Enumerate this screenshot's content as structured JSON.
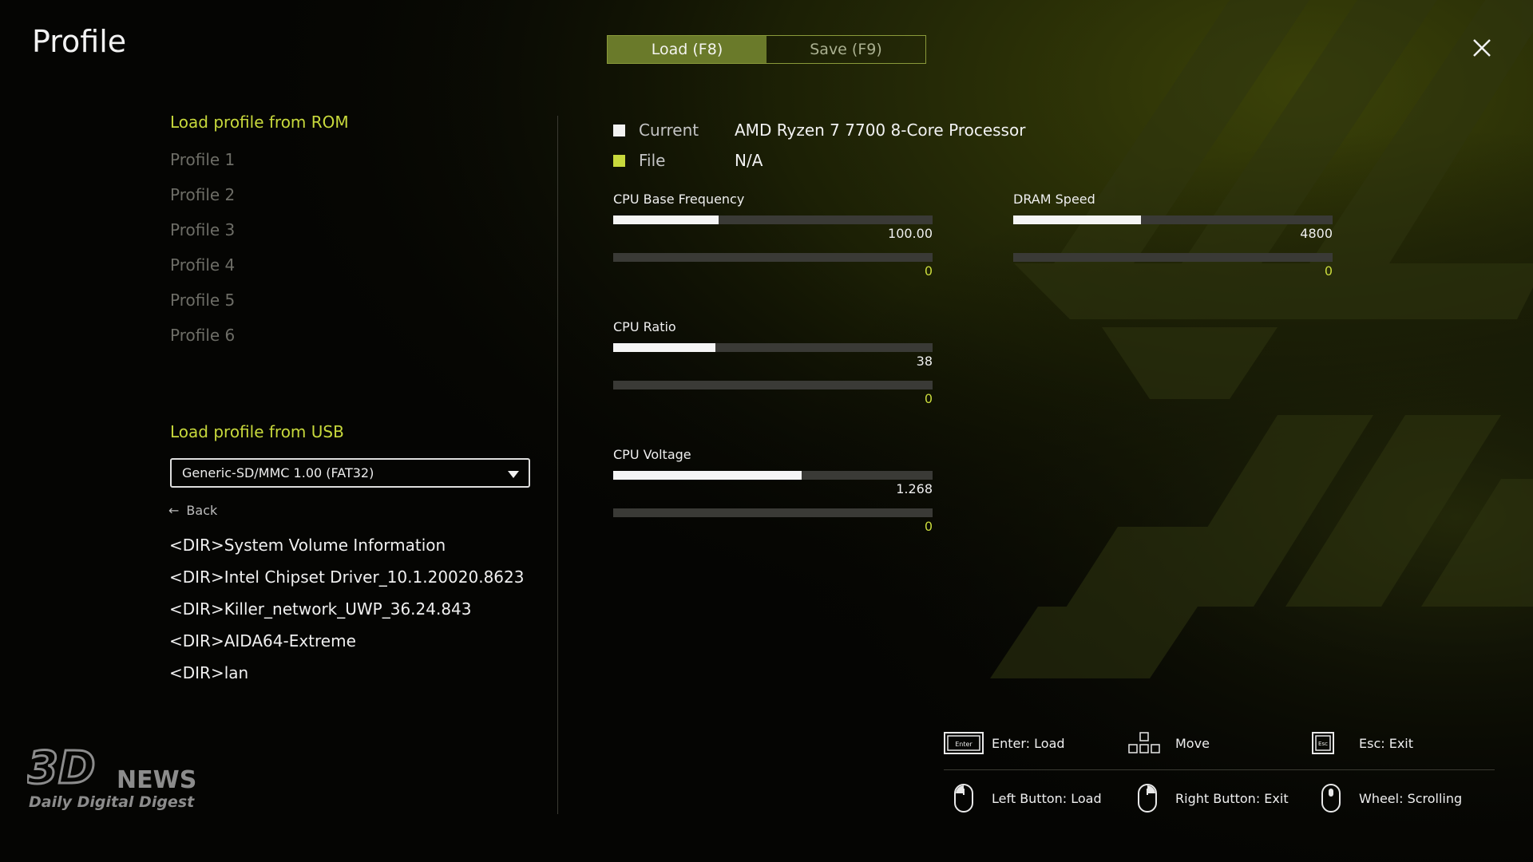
{
  "header": {
    "title": "Profile",
    "tabs": [
      {
        "label": "Load (F8)",
        "active": true
      },
      {
        "label": "Save (F9)",
        "active": false
      }
    ]
  },
  "left": {
    "rom_heading": "Load profile from ROM",
    "profiles": [
      "Profile 1",
      "Profile 2",
      "Profile 3",
      "Profile 4",
      "Profile 5",
      "Profile 6"
    ],
    "usb_heading": "Load profile from USB",
    "usb_device": "Generic-SD/MMC 1.00 (FAT32)",
    "back_label": "Back",
    "directories": [
      "<DIR>System Volume Information",
      "<DIR>Intel Chipset Driver_10.1.20020.8623",
      "<DIR>Killer_network_UWP_36.24.843",
      "<DIR>AIDA64-Extreme",
      "<DIR>lan"
    ]
  },
  "legend": {
    "current_label": "Current",
    "current_value": "AMD Ryzen 7 7700 8-Core Processor",
    "file_label": "File",
    "file_value": "N/A"
  },
  "metrics": {
    "cpu_base_frequency": {
      "name": "CPU Base Frequency",
      "current": "100.00",
      "current_fill": 0.33,
      "file": "0",
      "file_fill": 0
    },
    "dram_speed": {
      "name": "DRAM Speed",
      "current": "4800",
      "current_fill": 0.4,
      "file": "0",
      "file_fill": 0
    },
    "cpu_ratio": {
      "name": "CPU Ratio",
      "current": "38",
      "current_fill": 0.32,
      "file": "0",
      "file_fill": 0
    },
    "cpu_voltage": {
      "name": "CPU Voltage",
      "current": "1.268",
      "current_fill": 0.59,
      "file": "0",
      "file_fill": 0
    }
  },
  "hints": {
    "enter": "Enter: Load",
    "enter_key": "Enter",
    "move": "Move",
    "esc": "Esc: Exit",
    "esc_key": "Esc",
    "left_button": "Left Button: Load",
    "right_button": "Right Button: Exit",
    "wheel": "Wheel: Scrolling"
  },
  "watermark": {
    "logo_3d": "3D",
    "logo_news": "NEWS",
    "tagline": "Daily Digital Digest"
  },
  "colors": {
    "accent": "#c8d93c",
    "tab_active": "#6a7a2a",
    "current_swatch": "#f2f2f2",
    "file_swatch": "#c8d93c"
  }
}
